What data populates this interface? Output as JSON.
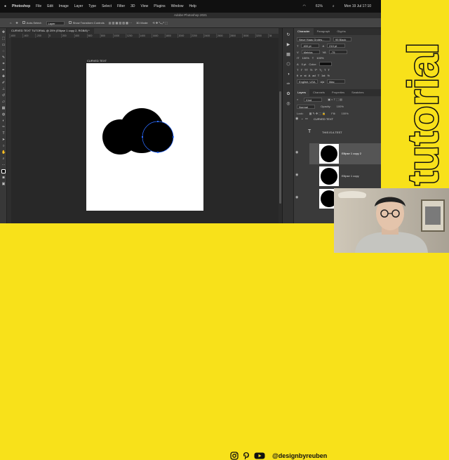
{
  "mac_menu": {
    "app": "Photoshop",
    "items": [
      "File",
      "Edit",
      "Image",
      "Layer",
      "Type",
      "Select",
      "Filter",
      "3D",
      "View",
      "Plugins",
      "Window",
      "Help"
    ],
    "battery": "61%",
    "clock": "Mon 19 Jul 17:10"
  },
  "window_title": "Adobe Photoshop 2021",
  "options_bar": {
    "auto_select": "Auto-Select:",
    "layer_select": "Layer",
    "transform": "Show Transform Controls",
    "mode_3d": "3D Mode:"
  },
  "document_tab": "CURVED TEXT TUTORIAL @ 25% (Ellipse 1 copy 2, RGB/8) *",
  "ruler_ticks": [
    "-600",
    "-400",
    "-200",
    "0",
    "200",
    "400",
    "600",
    "800",
    "1000",
    "1200",
    "1400",
    "1600",
    "1800",
    "2000",
    "2200",
    "2400",
    "2600",
    "2800",
    "3000",
    "3200",
    "34"
  ],
  "artboard_label": "CURVED TEXT",
  "character_panel": {
    "tabs": [
      "Character",
      "Paragraph",
      "Glyphs"
    ],
    "font_family": "Neue Haas Grotes...",
    "font_style": "95 Black",
    "size": "400 pt",
    "leading": "210 pt",
    "kerning": "Metrics",
    "tracking": "-75",
    "vscale": "100%",
    "hscale": "100%",
    "baseline": "0 pt",
    "color_label": "Color:",
    "language": "English: USA",
    "aa": "a|a",
    "aa_mode": "Mac"
  },
  "layers_panel": {
    "tabs": [
      "Layers",
      "Channels",
      "Properties",
      "Swatches"
    ],
    "kind": "Kind",
    "blend": "Normal",
    "opacity_label": "Opacity:",
    "opacity": "100%",
    "lock_label": "Lock:",
    "fill_label": "Fill:",
    "fill": "100%",
    "group": "CURVED TEXT",
    "layers": [
      {
        "name": "THIS IS A TEST",
        "type": "text"
      },
      {
        "name": "Ellipse 1 copy 2",
        "type": "shape",
        "selected": true
      },
      {
        "name": "Ellipse 1 copy",
        "type": "shape"
      },
      {
        "name": "Ellipse 1",
        "type": "shape"
      }
    ]
  },
  "branding": {
    "handle": "@designbyreuben",
    "word": "tutorial"
  },
  "colors": {
    "accent_yellow": "#f8e11a",
    "selection_blue": "#2b6bff"
  }
}
